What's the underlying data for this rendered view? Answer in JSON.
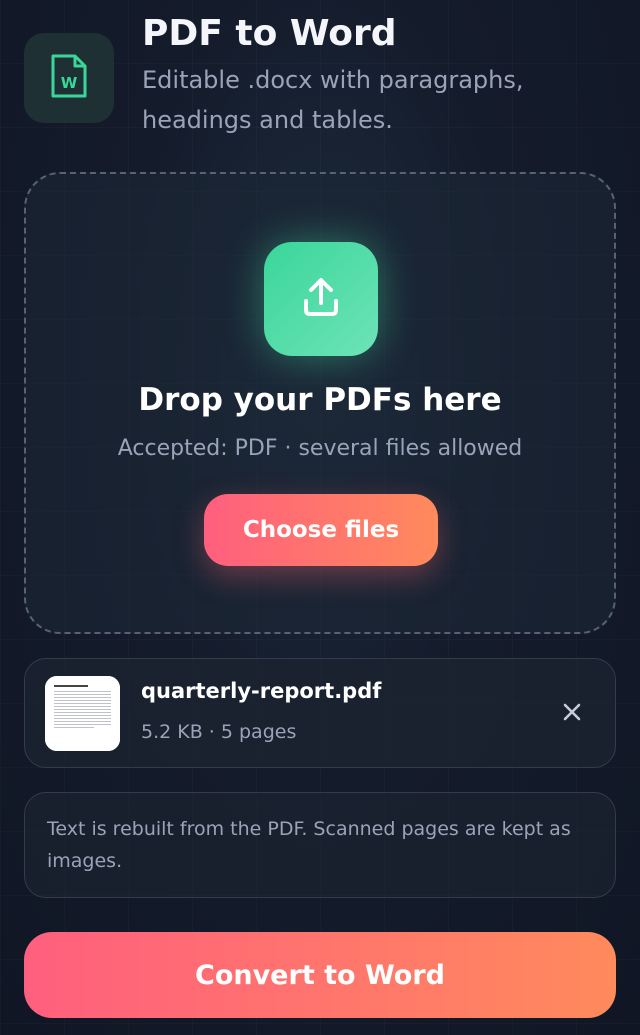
{
  "header": {
    "title": "PDF to Word",
    "subtitle": "Editable .docx with paragraphs, headings and tables.",
    "icon": "word-document-icon",
    "icon_letter": "W"
  },
  "dropzone": {
    "icon": "upload-icon",
    "title": "Drop your PDFs here",
    "subtitle": "Accepted: PDF · several files allowed",
    "button_label": "Choose files"
  },
  "files": [
    {
      "name": "quarterly-report.pdf",
      "meta": "5.2 KB · 5 pages",
      "thumbnail_icon": "pdf-page-thumbnail",
      "remove_icon": "close-icon"
    }
  ],
  "note": {
    "text": "Text is rebuilt from the PDF. Scanned pages are kept as images."
  },
  "convert": {
    "label": "Convert to Word"
  },
  "colors": {
    "accent_green": "#3ad69a",
    "accent_gradient_start": "#ff5f7e",
    "accent_gradient_end": "#ff8a5c",
    "background": "#141b2b",
    "muted_text": "#9aa3b8"
  }
}
